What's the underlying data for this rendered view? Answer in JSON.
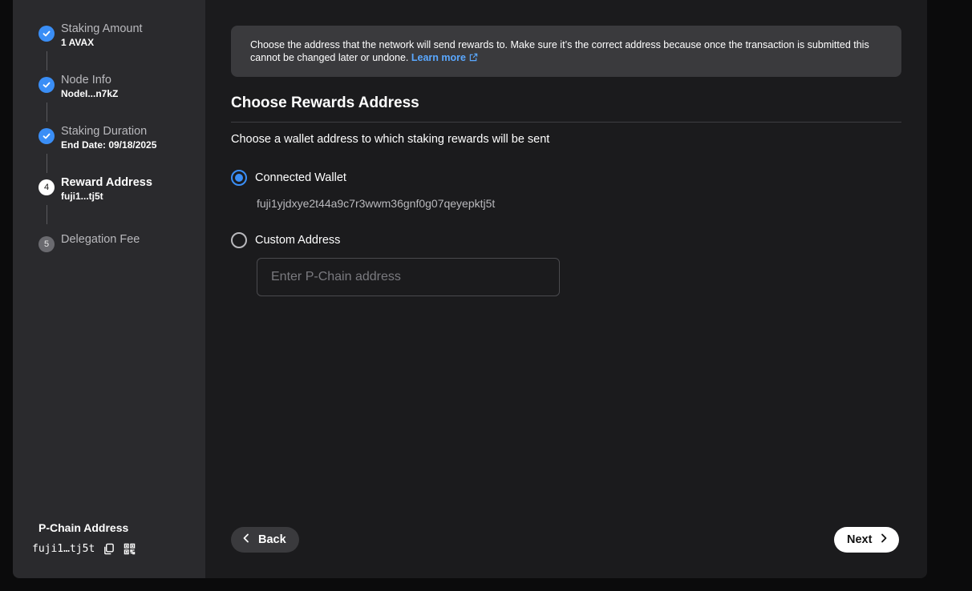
{
  "steps": [
    {
      "title": "Staking Amount",
      "subtitle": "1 AVAX",
      "status": "done"
    },
    {
      "title": "Node Info",
      "subtitle": "NodeI...n7kZ",
      "status": "done"
    },
    {
      "title": "Staking Duration",
      "subtitle": "End Date: 09/18/2025",
      "status": "done"
    },
    {
      "title": "Reward Address",
      "subtitle": "fuji1...tj5t",
      "status": "current",
      "number": "4"
    },
    {
      "title": "Delegation Fee",
      "subtitle": "",
      "status": "pending",
      "number": "5"
    }
  ],
  "pchain": {
    "label": "P-Chain Address",
    "address": "fuji1…tj5t",
    "copy_icon": "copy-icon",
    "qr_icon": "qr-code-icon"
  },
  "notice": {
    "text": "Choose the address that the network will send rewards to. Make sure it’s the correct address because once the transaction is submitted this cannot be changed later or undone.",
    "link_label": "Learn more",
    "link_icon": "external-link-icon"
  },
  "page": {
    "title": "Choose Rewards Address",
    "description": "Choose a wallet address to which staking rewards will be sent"
  },
  "options": {
    "connected_label": "Connected Wallet",
    "connected_address": "fuji1yjdxye2t44a9c7r3wwm36gnf0g07qeyepktj5t",
    "custom_label": "Custom Address",
    "custom_placeholder": "Enter P-Chain address",
    "selected": "connected"
  },
  "nav": {
    "back_label": "Back",
    "next_label": "Next"
  },
  "colors": {
    "accent": "#3a8ef6",
    "link": "#5aa8ff",
    "sidebar_bg": "#2a2a2d",
    "main_bg": "#1b1b1d"
  }
}
